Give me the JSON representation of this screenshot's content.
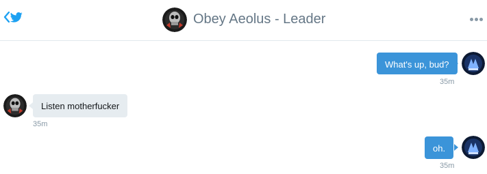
{
  "header": {
    "title": "Obey Aeolus - Leader",
    "back_icon": "chevron-left-icon",
    "app_icon": "twitter-bird-icon",
    "more_icon": "more-dots-icon",
    "accent_color": "#1da1f2"
  },
  "messages": [
    {
      "direction": "outgoing",
      "text": "What's up, bud?",
      "time": "35m"
    },
    {
      "direction": "incoming",
      "text": "Listen motherfucker",
      "time": "35m"
    },
    {
      "direction": "outgoing",
      "text": "oh.",
      "time": "35m"
    }
  ],
  "colors": {
    "outgoing_bubble": "#3b94d9",
    "incoming_bubble": "#e6ecf0",
    "timestamp": "#8899a6"
  }
}
